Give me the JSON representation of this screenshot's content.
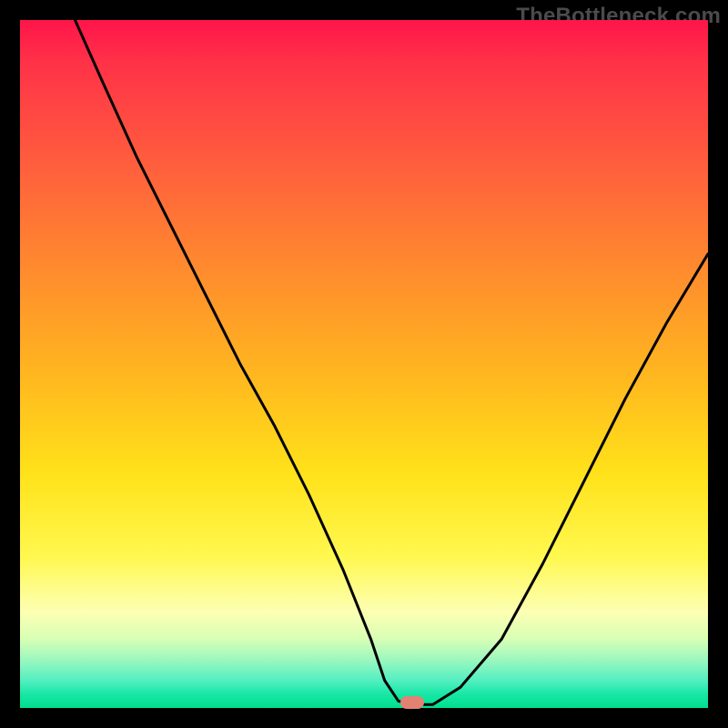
{
  "watermark": "TheBottleneck.com",
  "colors": {
    "frame": "#000000",
    "curve_stroke": "#000000",
    "marker_fill": "#e18273",
    "watermark_color": "#4b4b4b",
    "gradient_stops": [
      "#ff154a",
      "#ff5b3e",
      "#ff8a2e",
      "#ffb81f",
      "#ffe21a",
      "#fff84f",
      "#fdffb3",
      "#9cf7bf",
      "#00df8e"
    ]
  },
  "chart_data": {
    "type": "line",
    "title": "",
    "xlabel": "",
    "ylabel": "",
    "xlim": [
      0,
      100
    ],
    "ylim": [
      0,
      100
    ],
    "grid": false,
    "legend": false,
    "series": [
      {
        "name": "bottleneck-curve",
        "x": [
          8,
          12,
          17,
          22,
          27,
          32,
          37,
          42,
          47,
          51,
          53,
          55,
          57,
          60,
          64,
          70,
          76,
          82,
          88,
          94,
          100
        ],
        "y": [
          100,
          91,
          80,
          70,
          60,
          50,
          41,
          31,
          20,
          10,
          4,
          1,
          0.5,
          0.5,
          3,
          10,
          21,
          33,
          45,
          56,
          66
        ]
      }
    ],
    "marker": {
      "x": 57,
      "y": 0.5,
      "shape": "pill",
      "color": "#e18273"
    },
    "background": "vertical-gradient red→orange→yellow→green"
  }
}
